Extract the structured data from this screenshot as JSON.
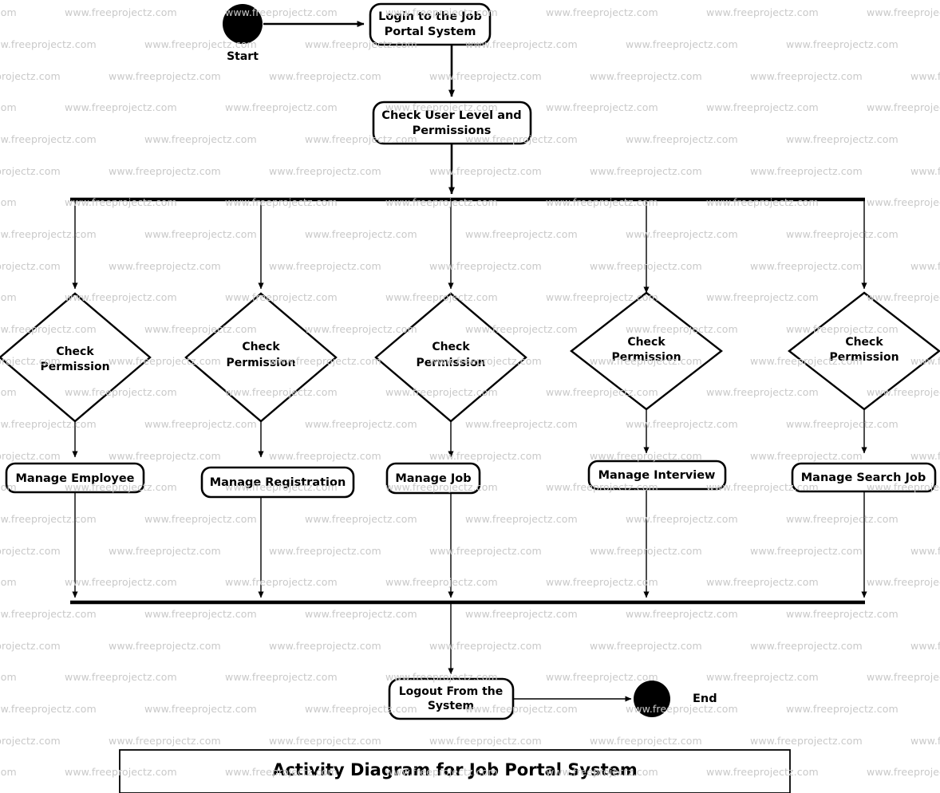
{
  "diagram": {
    "title": "Activity Diagram for Job Portal System",
    "type": "uml-activity-diagram",
    "start_label": "Start",
    "end_label": "End",
    "nodes": {
      "login": "Login to the Job Portal System",
      "check_user": "Check User Level and Permissions",
      "logout": "Logout From the System"
    },
    "decisions": [
      {
        "label": "Check Permission"
      },
      {
        "label": "Check Permission"
      },
      {
        "label": "Check Permission"
      },
      {
        "label": "Check Permission"
      },
      {
        "label": "Check Permission"
      }
    ],
    "activities": [
      {
        "label": "Manage Employee"
      },
      {
        "label": "Manage Registration"
      },
      {
        "label": "Manage Job"
      },
      {
        "label": "Manage Interview"
      },
      {
        "label": "Manage Search Job"
      }
    ]
  },
  "watermark": {
    "text": "www.freeprojectz.com",
    "color": "#c9c9c9"
  },
  "colors": {
    "stroke": "#000000",
    "fill": "#ffffff",
    "node": "#000000"
  }
}
